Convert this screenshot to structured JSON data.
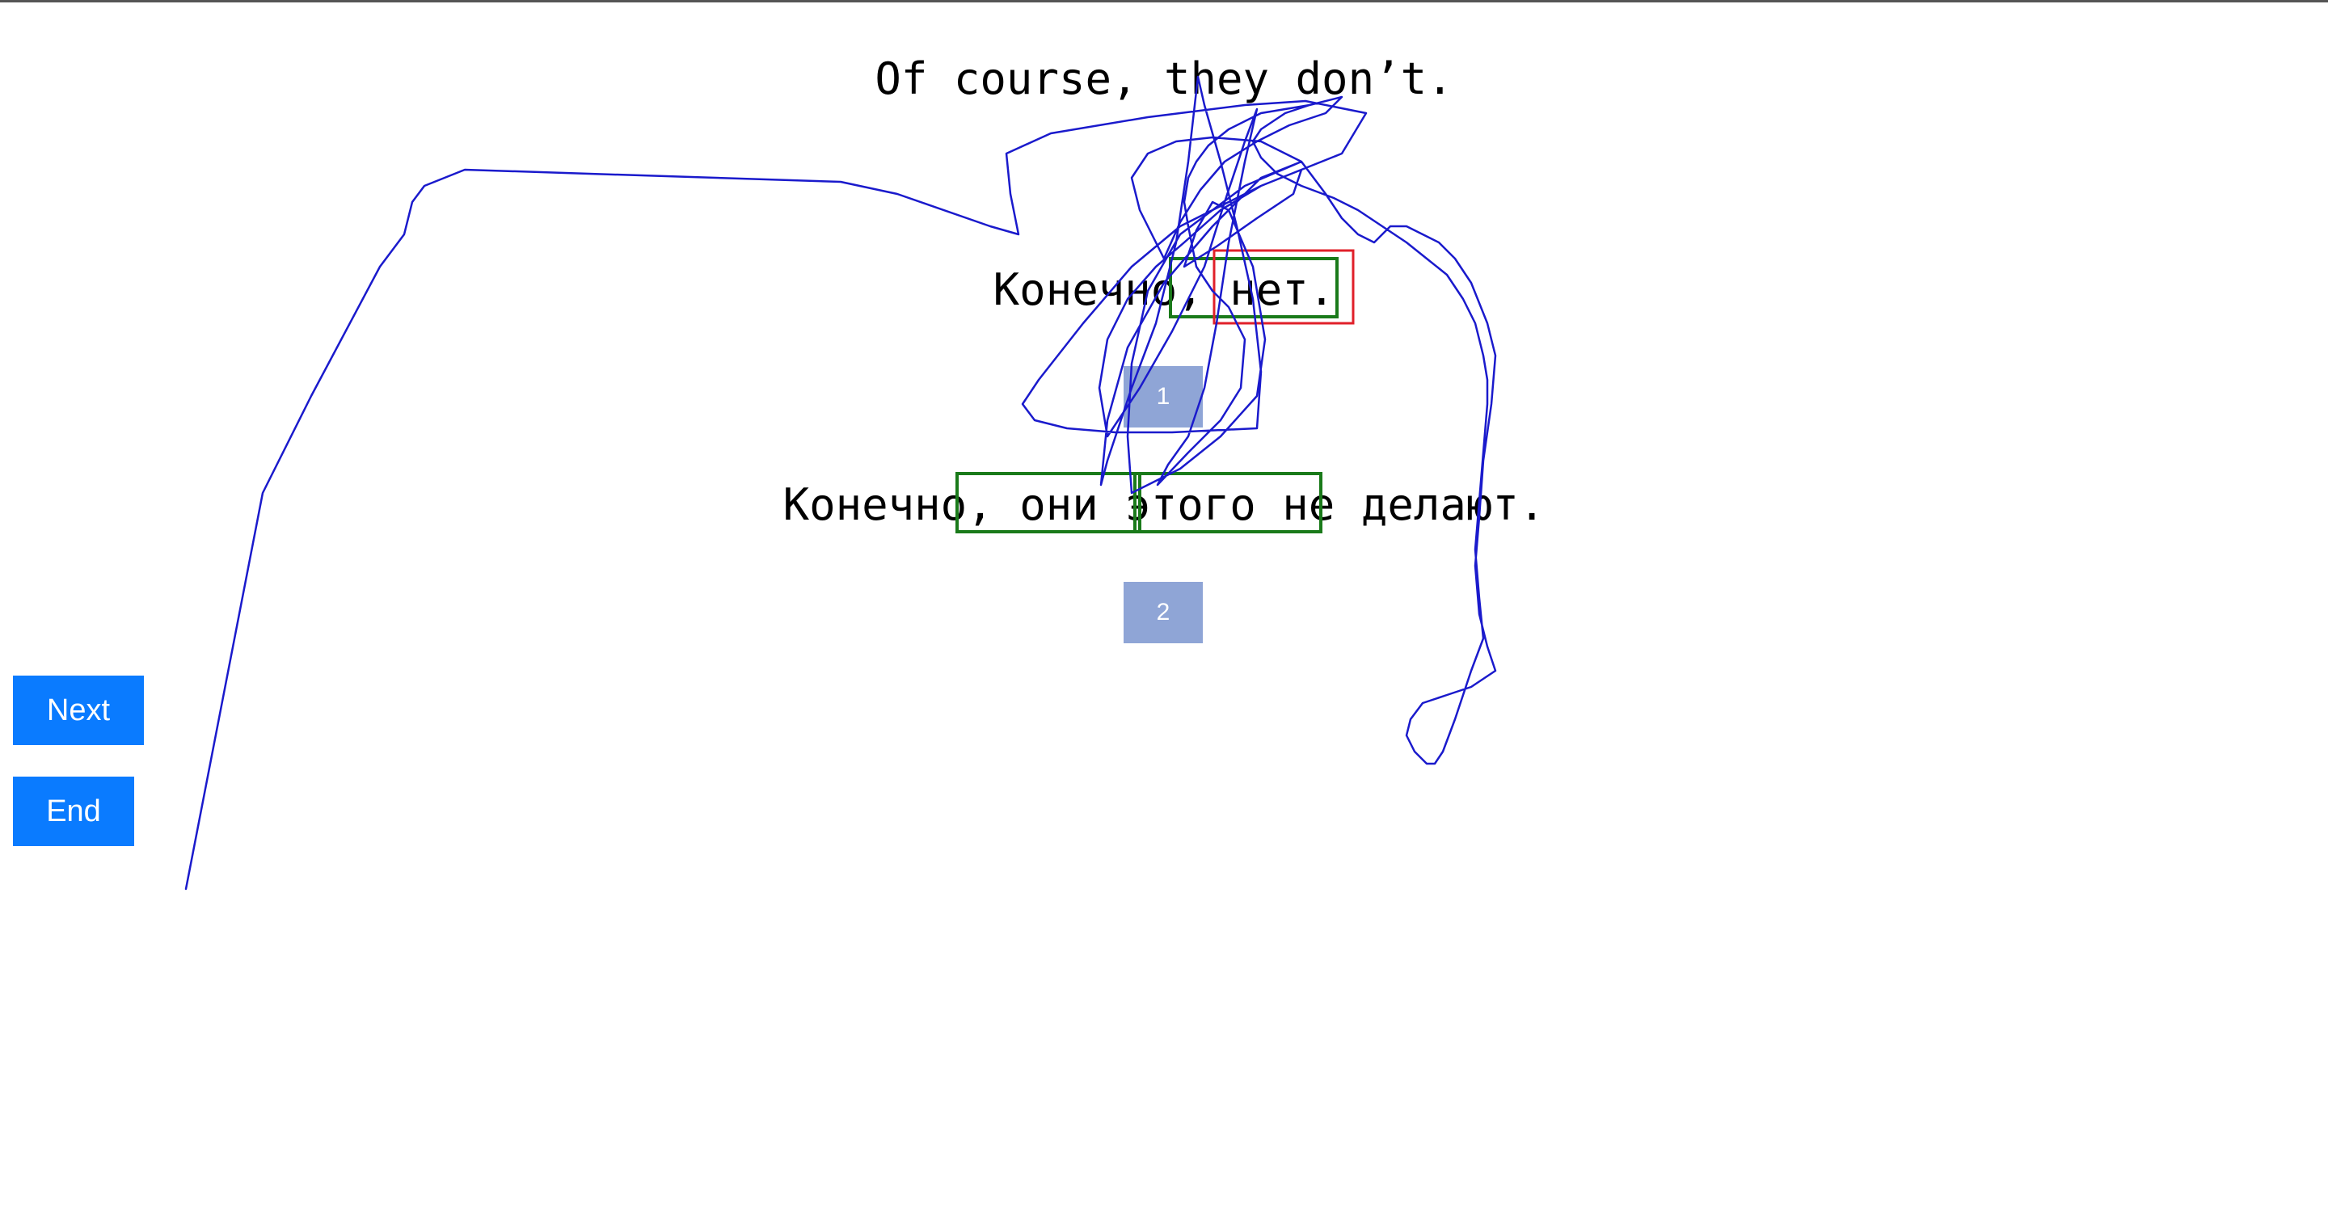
{
  "source_sentence": "Of course, they don’t.",
  "translations": [
    {
      "text": "Конечно, нет.",
      "rank_label": "1"
    },
    {
      "text": "Конечно, они этого не делают.",
      "rank_label": "2"
    }
  ],
  "buttons": {
    "next_label": "Next",
    "end_label": "End"
  },
  "colors": {
    "button": "#0a7bff",
    "rank_badge": "#8fa5d6",
    "gaze_trace": "#1a1acc",
    "highlight_green": "#1a7a1a",
    "highlight_red": "#e0202a"
  }
}
